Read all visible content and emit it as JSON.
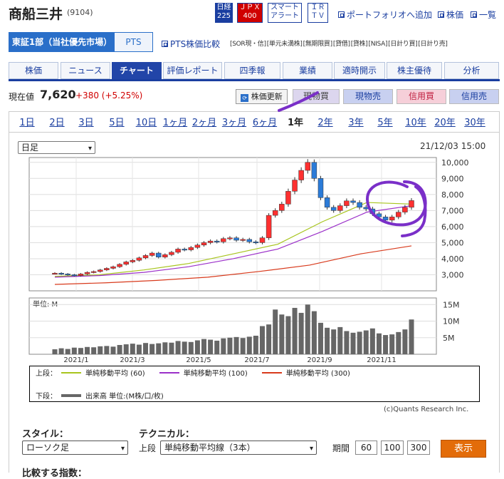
{
  "header": {
    "title": "商船三井",
    "code": "(9104)",
    "badges": [
      {
        "l1": "日経",
        "l2": "225",
        "fill": "#1a3ea0",
        "fg": "#fff"
      },
      {
        "l1": "ＪＰＸ",
        "l2": "400",
        "fill": "#d00000",
        "fg": "#fff"
      },
      {
        "l1": "スマート",
        "l2": "アラート",
        "fill": "#fff",
        "fg": "#1a3ea0"
      },
      {
        "l1": "ＩＲ",
        "l2": "ＴＶ",
        "fill": "#fff",
        "fg": "#1a3ea0"
      }
    ],
    "links": [
      "ポートフォリオへ追加",
      "株価",
      "一覧"
    ]
  },
  "market": {
    "active": "東証1部（当社優先市場）",
    "pts": "PTS",
    "pts_compare": "PTS株価比較"
  },
  "trade_badges": [
    "[SOR現・信]",
    "[単元未満株]",
    "[無期限買]",
    "[貸借]",
    "[貸株]",
    "[NISA]",
    "[日計り買]",
    "[日計り売]"
  ],
  "tabs": [
    "株価",
    "ニュース",
    "チャート",
    "評価レポート",
    "四季報",
    "業績",
    "適時開示",
    "株主優待",
    "分析"
  ],
  "price": {
    "label": "現在値",
    "value": "7,620",
    "change": "+380 (+5.25%)"
  },
  "actions": {
    "refresh": "株価更新",
    "buy": "現物買",
    "sell": "現物売",
    "margin_buy": "信用買",
    "margin_sell": "信用売"
  },
  "periods": [
    "1日",
    "2日",
    "3日",
    "5日",
    "10日",
    "1ヶ月",
    "2ヶ月",
    "3ヶ月",
    "6ヶ月",
    "1年",
    "2年",
    "3年",
    "5年",
    "10年",
    "20年",
    "30年"
  ],
  "active_period": "1年",
  "freq": "日足",
  "timestamp": "21/12/03 15:00",
  "chart_data": {
    "type": "line",
    "y_ticks": [
      "10,000",
      "9,000",
      "8,000",
      "7,000",
      "6,000",
      "5,000",
      "4,000",
      "3,000"
    ],
    "x_ticks": [
      "2021/1",
      "2021/3",
      "2021/5",
      "2021/7",
      "2021/9",
      "2021/11"
    ],
    "price_ylim": [
      2000,
      10300
    ],
    "volume_unit": "単位: M",
    "volume_ticks": [
      "15M",
      "10M",
      "5M"
    ],
    "series": [
      {
        "name": "単純移動平均 (60)",
        "color": "#a8c51e",
        "values": [
          2900,
          3000,
          3300,
          3700,
          4300,
          4900,
          6300,
          7500,
          7400
        ]
      },
      {
        "name": "単純移動平均 (100)",
        "color": "#9b30c9",
        "values": [
          2850,
          2950,
          3150,
          3500,
          4000,
          4600,
          5700,
          6900,
          7300
        ]
      },
      {
        "name": "単純移動平均 (300)",
        "color": "#d83a1c",
        "values": [
          2400,
          2500,
          2650,
          2850,
          3200,
          3600,
          4300,
          4800
        ]
      }
    ],
    "close": [
      3100,
      3050,
      3000,
      2950,
      3050,
      3150,
      3200,
      3300,
      3400,
      3500,
      3650,
      3800,
      3900,
      4050,
      4200,
      4350,
      4100,
      4250,
      4400,
      4600,
      4550,
      4700,
      4850,
      5000,
      5100,
      5050,
      5250,
      5300,
      5150,
      5200,
      5050,
      5000,
      5300,
      6700,
      7000,
      7400,
      8200,
      8900,
      9500,
      10000,
      9000,
      7800,
      7200,
      7000,
      7300,
      7600,
      7500,
      7200,
      7100,
      6800,
      6600,
      6400,
      6600,
      6900,
      7200,
      7620
    ],
    "volume": [
      1.5,
      1.8,
      1.6,
      2.0,
      1.9,
      2.2,
      2.1,
      2.4,
      2.5,
      2.3,
      2.8,
      3.0,
      3.2,
      2.9,
      3.4,
      3.1,
      3.3,
      3.6,
      3.5,
      4.0,
      3.8,
      3.7,
      4.2,
      4.6,
      4.4,
      4.1,
      4.8,
      5.0,
      5.2,
      4.9,
      5.3,
      5.6,
      8.5,
      9.0,
      13.5,
      12.0,
      11.5,
      14.0,
      12.5,
      15.0,
      13.0,
      9.5,
      8.0,
      7.5,
      8.2,
      7.0,
      6.5,
      6.8,
      7.2,
      7.8,
      6.3,
      5.8,
      6.0,
      6.7,
      7.5,
      10.5
    ]
  },
  "legend": {
    "upper": "上段：",
    "lower": "下段：",
    "volume_label": "出来高 単位:(M株/口/枚)"
  },
  "copyright": "(c)Quants Research Inc.",
  "controls": {
    "style_label": "スタイル：",
    "style_value": "ローソク足",
    "tech_label": "テクニカル：",
    "upper_label": "上段",
    "tech_value": "単純移動平均線（3本）",
    "period_label": "期間",
    "periods": [
      "60",
      "100",
      "300"
    ],
    "show": "表示",
    "compare_label": "比較する指数："
  }
}
